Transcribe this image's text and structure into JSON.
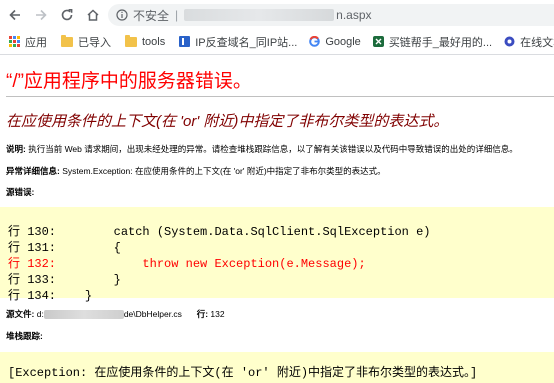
{
  "browser": {
    "insecure_label": "不安全",
    "url_separator": "|",
    "url_tail": "n.aspx",
    "bookmarks": [
      {
        "label": "应用",
        "icon": "apps-grid-icon"
      },
      {
        "label": "已导入",
        "icon": "folder-icon"
      },
      {
        "label": "tools",
        "icon": "folder-icon"
      },
      {
        "label": "IP反查域名_同IP站...",
        "icon": "ip-site-icon"
      },
      {
        "label": "Google",
        "icon": "google-icon"
      },
      {
        "label": "买链帮手_最好用的...",
        "icon": "link-helper-icon"
      },
      {
        "label": "在线文本去重",
        "icon": "dedupe-icon"
      }
    ]
  },
  "page": {
    "title": "“/”应用程序中的服务器错误。",
    "subtitle": "在应使用条件的上下文(在 'or' 附近)中指定了非布尔类型的表达式。",
    "description_label": "说明:",
    "description_text": " 执行当前 Web 请求期间，出现未经处理的异常。请检查堆栈跟踪信息，以了解有关该错误以及代码中导致错误的出处的详细信息。",
    "exception_label": "异常详细信息:",
    "exception_text": " System.Exception: 在应使用条件的上下文(在 'or' 附近)中指定了非布尔类型的表达式。",
    "source_error_label": "源错误:",
    "code_lines": [
      {
        "num": "行 130:",
        "code": "        catch (System.Data.SqlClient.SqlException e)",
        "highlight": false
      },
      {
        "num": "行 131:",
        "code": "        {",
        "highlight": false
      },
      {
        "num": "行 132:",
        "code": "            throw new Exception(e.Message);",
        "highlight": true
      },
      {
        "num": "行 133:",
        "code": "        }",
        "highlight": false
      },
      {
        "num": "行 134:",
        "code": "    }",
        "highlight": false
      }
    ],
    "source_file_label": "源文件:",
    "source_file_prefix": "d:",
    "source_file_suffix": "de\\DbHelper.cs",
    "line_label": "行:",
    "line_value": "132",
    "stack_trace_label": "堆栈跟踪:",
    "stack_trace_first_line": "[Exception: 在应使用条件的上下文(在 'or' 附近)中指定了非布尔类型的表达式。]"
  },
  "colors": {
    "title": "#ff0000",
    "subtitle": "#800000",
    "code_background": "#ffffcc",
    "highlight_line": "#ff0000"
  }
}
